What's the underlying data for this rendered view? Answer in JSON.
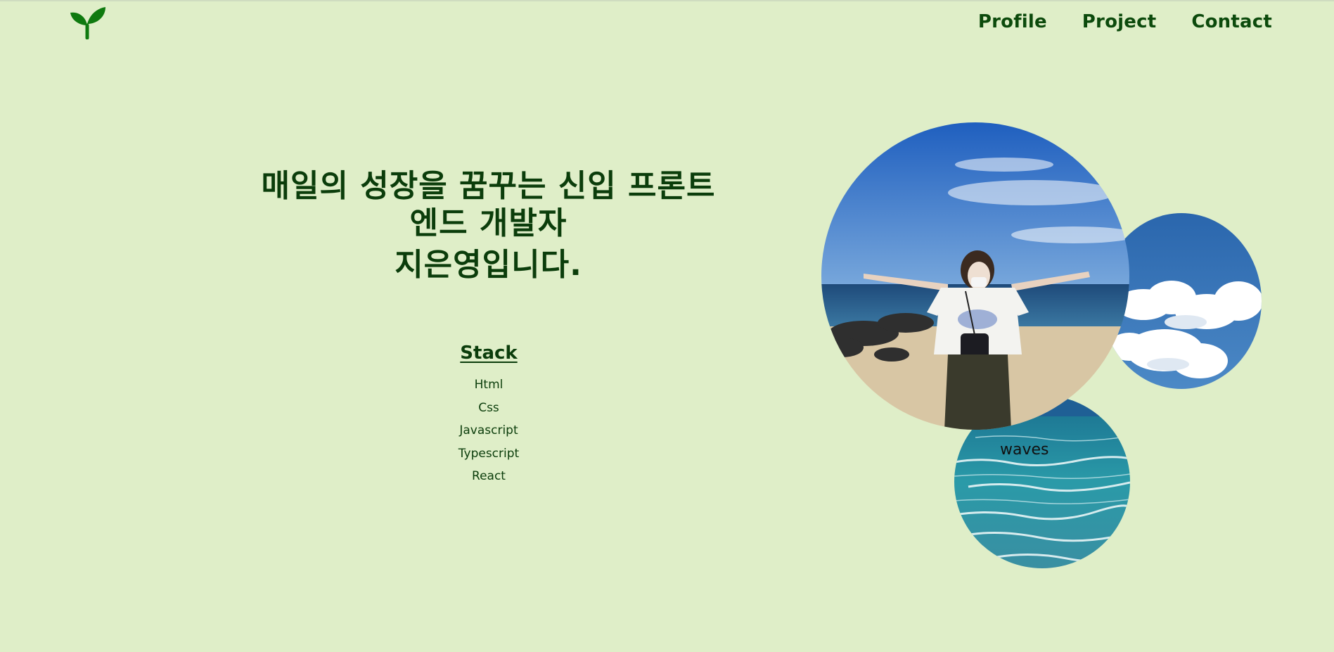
{
  "header": {
    "logo_icon": "sprout-icon",
    "nav": [
      {
        "label": "Profile"
      },
      {
        "label": "Project"
      },
      {
        "label": "Contact"
      }
    ]
  },
  "hero": {
    "line1": "매일의 성장을 꿈꾸는 신입 프론트엔드 개발자",
    "line2": "지은영입니다."
  },
  "stack": {
    "title": "Stack",
    "items": [
      "Html",
      "Css",
      "Javascript",
      "Typescript",
      "React"
    ]
  },
  "gallery": {
    "waves_label": "waves"
  },
  "colors": {
    "background": "#dfeec8",
    "text": "#0b3d0b",
    "accent": "#0f7a0f"
  }
}
